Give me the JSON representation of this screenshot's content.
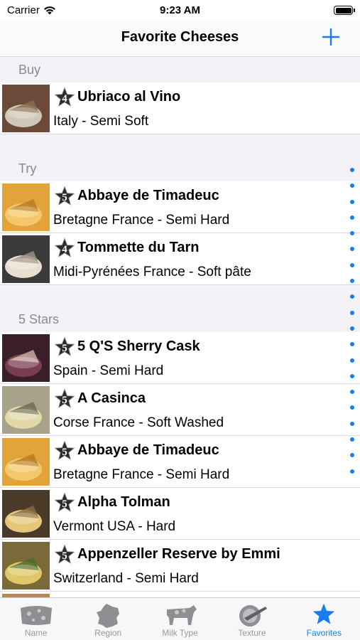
{
  "status": {
    "carrier": "Carrier",
    "time": "9:23 AM"
  },
  "nav": {
    "title": "Favorite Cheeses",
    "add_icon": "plus-icon"
  },
  "sections": [
    {
      "title": "Buy",
      "rows": [
        {
          "rating": "4",
          "name": "Ubriaco al Vino",
          "detail": "Italy - Semi Soft"
        }
      ]
    },
    {
      "title": "Try",
      "rows": [
        {
          "rating": "5",
          "name": "Abbaye de Timadeuc",
          "detail": "Bretagne France - Semi Hard"
        },
        {
          "rating": "4",
          "name": "Tommette du Tarn",
          "detail": "Midi-Pyrénées France - Soft pâte"
        }
      ]
    },
    {
      "title": "5 Stars",
      "rows": [
        {
          "rating": "5",
          "name": "5 Q'S Sherry Cask",
          "detail": "Spain - Semi Hard"
        },
        {
          "rating": "5",
          "name": "A Casinca",
          "detail": "Corse France - Soft Washed"
        },
        {
          "rating": "5",
          "name": "Abbaye de Timadeuc",
          "detail": "Bretagne France - Semi Hard"
        },
        {
          "rating": "5",
          "name": "Alpha Tolman",
          "detail": "Vermont USA - Hard"
        },
        {
          "rating": "5",
          "name": "Appenzeller Reserve by Emmi",
          "detail": "Switzerland - Semi Hard"
        }
      ]
    }
  ],
  "tabs": [
    {
      "label": "Name",
      "icon": "cheese-wedge-icon",
      "active": false
    },
    {
      "label": "Region",
      "icon": "france-map-icon",
      "active": false
    },
    {
      "label": "Milk Type",
      "icon": "cow-icon",
      "active": false
    },
    {
      "label": "Texture",
      "icon": "knife-plate-icon",
      "active": false
    },
    {
      "label": "Favorites",
      "icon": "star-icon",
      "active": true
    }
  ],
  "colors": {
    "accent": "#1a7cf2",
    "section_bg": "#f2f2f7",
    "inactive_tab": "#999999"
  }
}
